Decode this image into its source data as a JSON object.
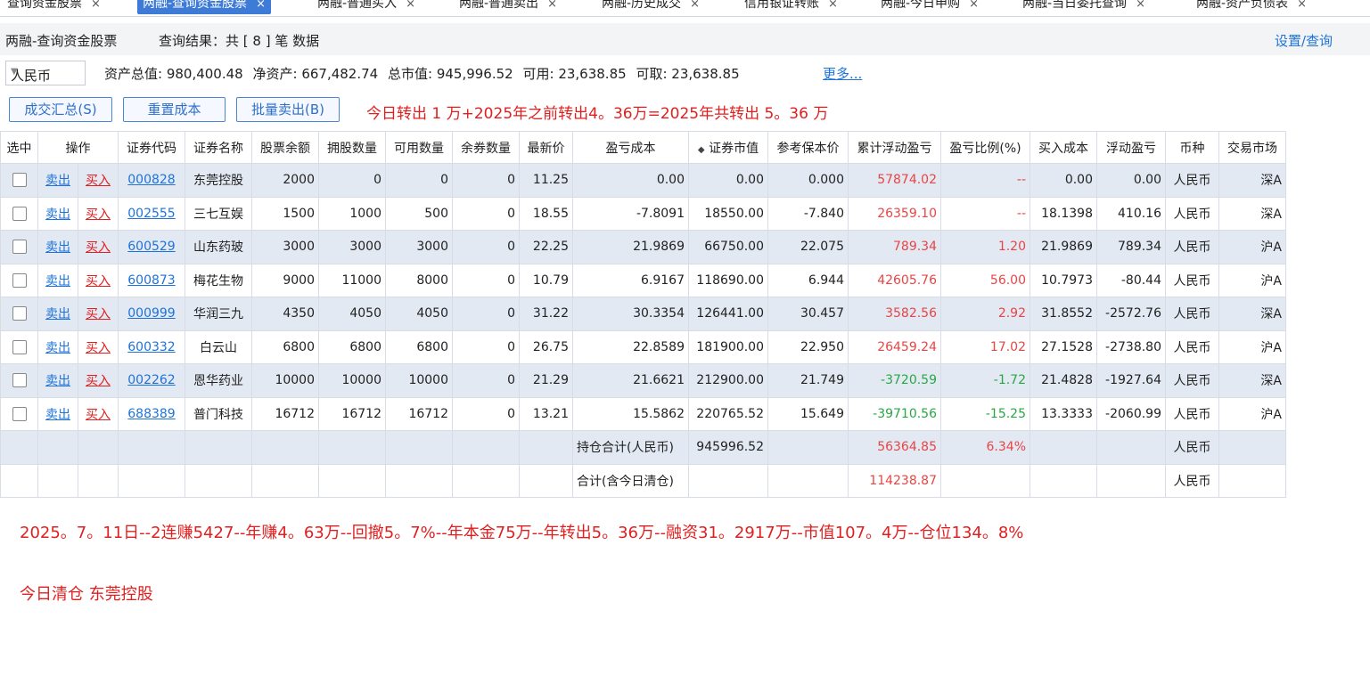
{
  "tabs": [
    {
      "label": "查询资金股票",
      "active": false
    },
    {
      "label": "两融-查询资金股票",
      "active": true
    },
    {
      "label": "两融-普通买入",
      "active": false
    },
    {
      "label": "两融-普通卖出",
      "active": false
    },
    {
      "label": "两融-历史成交",
      "active": false
    },
    {
      "label": "信用银证转账",
      "active": false
    },
    {
      "label": "两融-今日申购",
      "active": false
    },
    {
      "label": "两融-当日委托查询",
      "active": false
    },
    {
      "label": "两融-资产负债表",
      "active": false
    }
  ],
  "close_glyph": "×",
  "header": {
    "title": "两融-查询资金股票",
    "result": "查询结果：共 [ 8 ] 笔 数据",
    "settings": "设置/查询"
  },
  "currency_select": {
    "value": "人民币"
  },
  "summary": {
    "total_assets": "资产总值: 980,400.48",
    "net_assets": "净资产: 667,482.74",
    "market_value": "总市值: 945,996.52",
    "available": "可用: 23,638.85",
    "withdrawable": "可取: 23,638.85",
    "more": "更多..."
  },
  "buttons": {
    "trade_summary": "成交汇总(S)",
    "reset_cost": "重置成本",
    "batch_sell": "批量卖出(B)"
  },
  "note_transfer": "今日转出 1 万+2025年之前转出4。36万=2025年共转出  5。36 万",
  "table": {
    "columns": [
      "选中",
      "操作",
      "",
      "证券代码",
      "证券名称",
      "股票余额",
      "拥股数量",
      "可用数量",
      "余券数量",
      "最新价",
      "盈亏成本",
      "证券市值",
      "参考保本价",
      "累计浮动盈亏",
      "盈亏比例(%)",
      "买入成本",
      "浮动盈亏",
      "币种",
      "交易市场"
    ],
    "sort_glyph": "◆",
    "sell_label": "卖出",
    "buy_label": "买入",
    "rows": [
      {
        "code": "000828",
        "name": "东莞控股",
        "balance": "2000",
        "held": "0",
        "avail": "0",
        "lend": "0",
        "price": "11.25",
        "pl_cost": "0.00",
        "mkt": "0.00",
        "breakeven": "0.000",
        "cum_pl": "57874.02",
        "pl_pct": "--",
        "buy_cost": "0.00",
        "float_pl": "0.00",
        "currency": "人民币",
        "market": "深A",
        "sign": "pos"
      },
      {
        "code": "002555",
        "name": "三七互娱",
        "balance": "1500",
        "held": "1000",
        "avail": "500",
        "lend": "0",
        "price": "18.55",
        "pl_cost": "-7.8091",
        "mkt": "18550.00",
        "breakeven": "-7.840",
        "cum_pl": "26359.10",
        "pl_pct": "--",
        "buy_cost": "18.1398",
        "float_pl": "410.16",
        "currency": "人民币",
        "market": "深A",
        "sign": "pos"
      },
      {
        "code": "600529",
        "name": "山东药玻",
        "balance": "3000",
        "held": "3000",
        "avail": "3000",
        "lend": "0",
        "price": "22.25",
        "pl_cost": "21.9869",
        "mkt": "66750.00",
        "breakeven": "22.075",
        "cum_pl": "789.34",
        "pl_pct": "1.20",
        "buy_cost": "21.9869",
        "float_pl": "789.34",
        "currency": "人民币",
        "market": "沪A",
        "sign": "pos"
      },
      {
        "code": "600873",
        "name": "梅花生物",
        "balance": "9000",
        "held": "11000",
        "avail": "8000",
        "lend": "0",
        "price": "10.79",
        "pl_cost": "6.9167",
        "mkt": "118690.00",
        "breakeven": "6.944",
        "cum_pl": "42605.76",
        "pl_pct": "56.00",
        "buy_cost": "10.7973",
        "float_pl": "-80.44",
        "currency": "人民币",
        "market": "沪A",
        "sign": "pos"
      },
      {
        "code": "000999",
        "name": "华润三九",
        "balance": "4350",
        "held": "4050",
        "avail": "4050",
        "lend": "0",
        "price": "31.22",
        "pl_cost": "30.3354",
        "mkt": "126441.00",
        "breakeven": "30.457",
        "cum_pl": "3582.56",
        "pl_pct": "2.92",
        "buy_cost": "31.8552",
        "float_pl": "-2572.76",
        "currency": "人民币",
        "market": "深A",
        "sign": "pos"
      },
      {
        "code": "600332",
        "name": "白云山",
        "balance": "6800",
        "held": "6800",
        "avail": "6800",
        "lend": "0",
        "price": "26.75",
        "pl_cost": "22.8589",
        "mkt": "181900.00",
        "breakeven": "22.950",
        "cum_pl": "26459.24",
        "pl_pct": "17.02",
        "buy_cost": "27.1528",
        "float_pl": "-2738.80",
        "currency": "人民币",
        "market": "沪A",
        "sign": "pos"
      },
      {
        "code": "002262",
        "name": "恩华药业",
        "balance": "10000",
        "held": "10000",
        "avail": "10000",
        "lend": "0",
        "price": "21.29",
        "pl_cost": "21.6621",
        "mkt": "212900.00",
        "breakeven": "21.749",
        "cum_pl": "-3720.59",
        "pl_pct": "-1.72",
        "buy_cost": "21.4828",
        "float_pl": "-1927.64",
        "currency": "人民币",
        "market": "深A",
        "sign": "neg"
      },
      {
        "code": "688389",
        "name": "普门科技",
        "balance": "16712",
        "held": "16712",
        "avail": "16712",
        "lend": "0",
        "price": "13.21",
        "pl_cost": "15.5862",
        "mkt": "220765.52",
        "breakeven": "15.649",
        "cum_pl": "-39710.56",
        "pl_pct": "-15.25",
        "buy_cost": "13.3333",
        "float_pl": "-2060.99",
        "currency": "人民币",
        "market": "沪A",
        "sign": "neg"
      }
    ],
    "total_holding": {
      "label": "持仓合计(人民币)",
      "mkt": "945996.52",
      "cum_pl": "56364.85",
      "pl_pct": "6.34%",
      "currency": "人民币"
    },
    "total_all": {
      "label": "合计(含今日清仓)",
      "cum_pl": "114238.87",
      "currency": "人民币"
    }
  },
  "note_summary": "2025。7。11日--2连赚5427--年赚4。63万--回撤5。7%--年本金75万--年转出5。36万--融资31。2917万--市值107。4万--仓位134。8%",
  "note_clear": "今日清仓 东莞控股",
  "colors": {
    "accent": "#3d7bd6",
    "link": "#1e73d8",
    "red": "#e84545",
    "green": "#28a745",
    "row_alt": "#e3e9f3"
  }
}
